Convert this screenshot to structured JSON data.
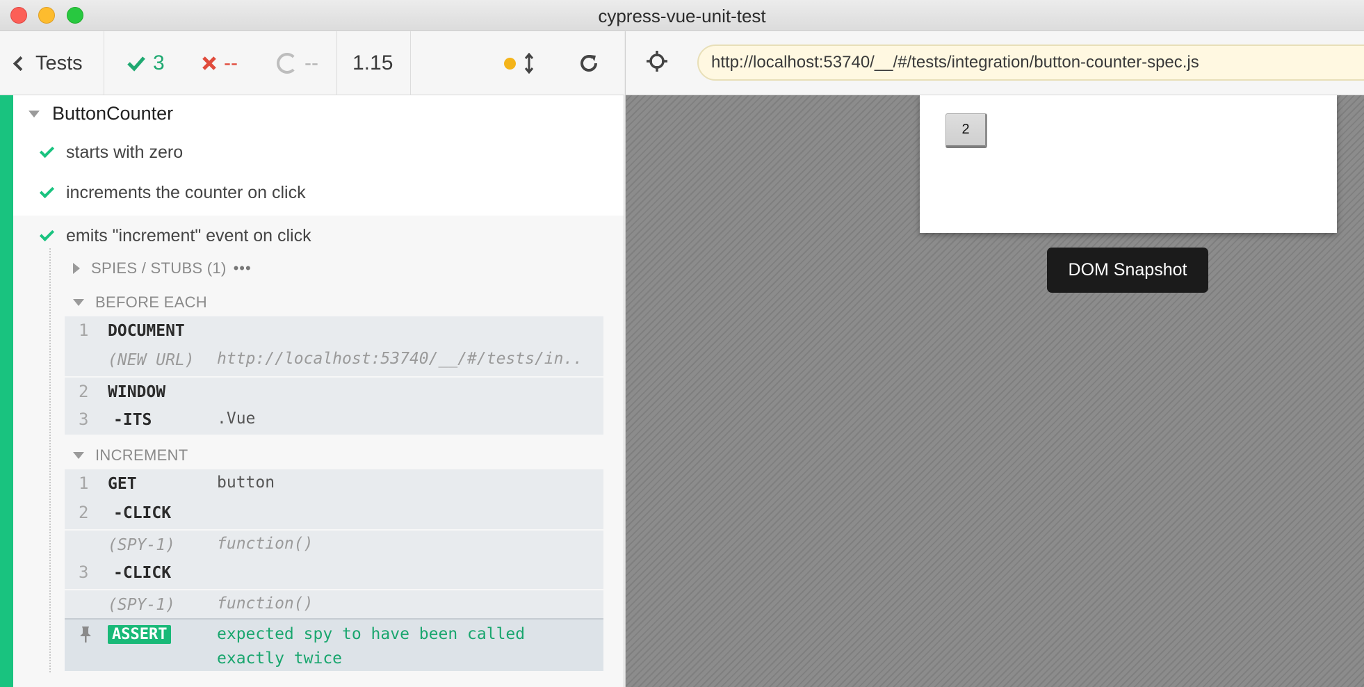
{
  "window": {
    "title": "cypress-vue-unit-test"
  },
  "header": {
    "tests_label": "Tests",
    "passed_count": "3",
    "failed_count": "--",
    "pending_count": "--",
    "duration": "1.15",
    "colors": {
      "passed": "#1fa971",
      "failed": "#e04b3c",
      "pending": "#b4b4b4",
      "autoscroll_dot": "#f4b41a"
    }
  },
  "aut": {
    "url": "http://localhost:53740/__/#/tests/integration/button-counter-spec.js",
    "counter_button_label": "2",
    "snapshot_label": "DOM Snapshot"
  },
  "suite": {
    "title": "ButtonCounter",
    "tests": [
      {
        "title": "starts with zero",
        "state": "passed"
      },
      {
        "title": "increments the counter on click",
        "state": "passed"
      },
      {
        "title": "emits \"increment\" event on click",
        "state": "passed"
      }
    ]
  },
  "spies": {
    "label": "SPIES / STUBS (1)",
    "more": "•••"
  },
  "hooks": {
    "before_each": {
      "label": "BEFORE EACH",
      "commands": [
        {
          "num": "1",
          "name": "DOCUMENT",
          "message": ""
        },
        {
          "num": "",
          "name": "(NEW URL)",
          "message": "http://localhost:53740/__/#/tests/in.."
        },
        {
          "num": "2",
          "name": "WINDOW",
          "message": ""
        },
        {
          "num": "3",
          "name": "-ITS",
          "message": ".Vue"
        }
      ]
    },
    "increment": {
      "label": "INCREMENT",
      "commands": [
        {
          "num": "1",
          "name": "GET",
          "message": "button"
        },
        {
          "num": "2",
          "name": "-CLICK",
          "message": ""
        },
        {
          "num": "",
          "name": "(SPY-1)",
          "message": "function()"
        },
        {
          "num": "3",
          "name": "-CLICK",
          "message": ""
        },
        {
          "num": "",
          "name": "(SPY-1)",
          "message": "function()"
        }
      ],
      "assert": {
        "badge": "ASSERT",
        "message": "expected spy to have been called exactly twice"
      }
    }
  },
  "icons": [
    "chevron-left-icon",
    "check-icon",
    "x-icon",
    "pending-ring-icon",
    "autoscroll-dot-icon",
    "vertical-arrows-icon",
    "reload-icon",
    "crosshair-icon",
    "pin-icon"
  ]
}
